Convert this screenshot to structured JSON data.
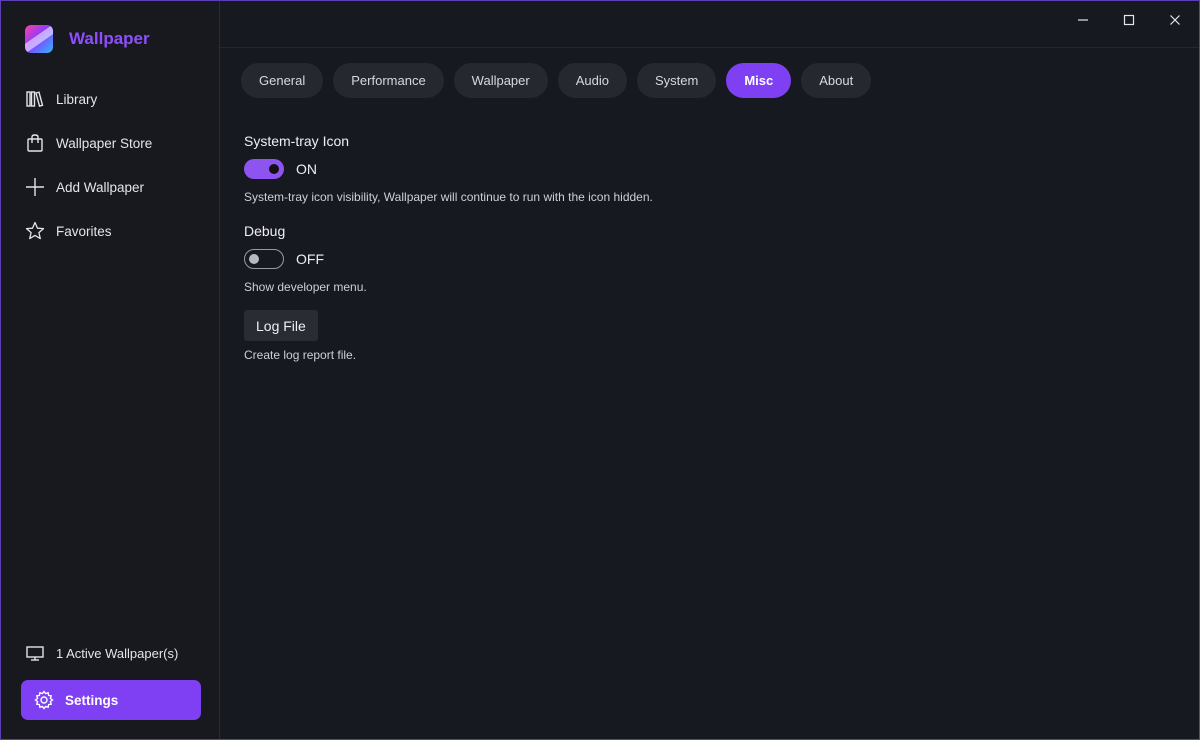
{
  "app": {
    "name": "Wallpaper"
  },
  "colors": {
    "accent": "#7f3ff2",
    "brand_text": "#8f4dff",
    "background": "#171920"
  },
  "sidebar": {
    "items": [
      {
        "label": "Library",
        "icon": "library-icon"
      },
      {
        "label": "Wallpaper Store",
        "icon": "store-bag-icon"
      },
      {
        "label": "Add Wallpaper",
        "icon": "plus-icon"
      },
      {
        "label": "Favorites",
        "icon": "star-icon"
      }
    ],
    "active_wallpapers": "1 Active Wallpaper(s)",
    "settings_label": "Settings"
  },
  "tabs": [
    {
      "label": "General",
      "active": false
    },
    {
      "label": "Performance",
      "active": false
    },
    {
      "label": "Wallpaper",
      "active": false
    },
    {
      "label": "Audio",
      "active": false
    },
    {
      "label": "System",
      "active": false
    },
    {
      "label": "Misc",
      "active": true
    },
    {
      "label": "About",
      "active": false
    }
  ],
  "misc": {
    "systray": {
      "title": "System-tray Icon",
      "state": "ON",
      "description": "System-tray icon visibility, Wallpaper will continue to run with the icon hidden."
    },
    "debug": {
      "title": "Debug",
      "state": "OFF",
      "description": "Show developer menu."
    },
    "log": {
      "button_label": "Log File",
      "description": "Create log report file."
    }
  }
}
